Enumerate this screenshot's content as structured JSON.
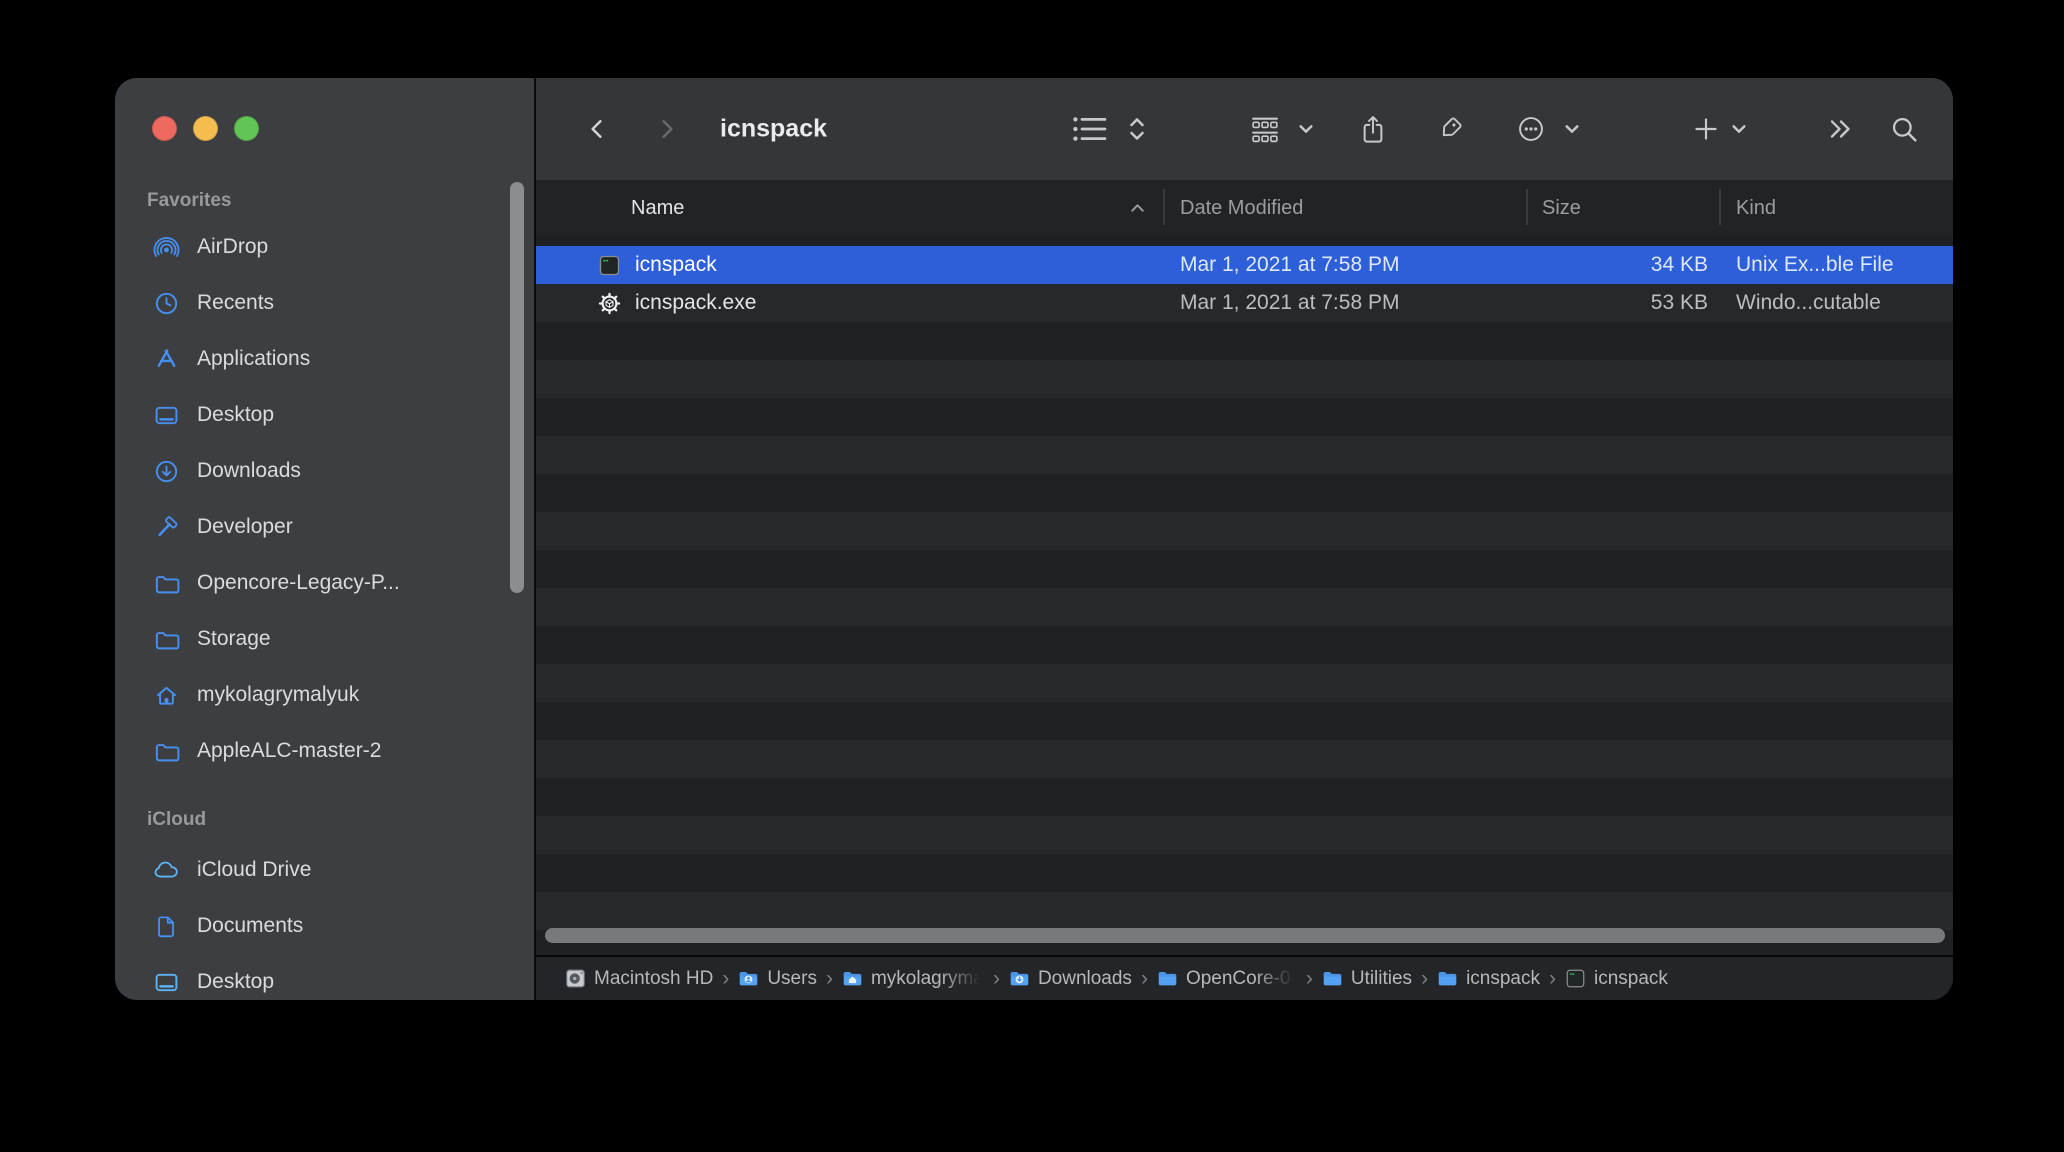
{
  "window": {
    "title": "icnspack"
  },
  "colors": {
    "accent_blue": "#2d5fd9",
    "sidebar_icon_blue": "#4690f3",
    "sidebar_icon_light_blue": "#5cb3f6",
    "folder_blue": "#55a1f2",
    "traffic_red": "#ee6a5f",
    "traffic_yellow": "#f5bd4f",
    "traffic_green": "#62c454"
  },
  "toolbar": {
    "icons": [
      "chevron-left-icon",
      "chevron-right-icon",
      "list-view-icon",
      "chevrons-up-down-icon",
      "group-view-icon",
      "share-icon",
      "tag-icon",
      "ellipsis-circle-icon",
      "chevron-down-icon",
      "plus-icon",
      "double-chevron-icon",
      "search-icon"
    ]
  },
  "sidebar": {
    "sections": [
      {
        "title": "Favorites",
        "items": [
          {
            "label": "AirDrop",
            "icon": "airdrop-icon"
          },
          {
            "label": "Recents",
            "icon": "clock-icon"
          },
          {
            "label": "Applications",
            "icon": "appstore-icon"
          },
          {
            "label": "Desktop",
            "icon": "desktop-icon"
          },
          {
            "label": "Downloads",
            "icon": "download-circle-icon"
          },
          {
            "label": "Developer",
            "icon": "hammer-icon"
          },
          {
            "label": "Opencore-Legacy-P...",
            "icon": "folder-icon"
          },
          {
            "label": "Storage",
            "icon": "folder-icon"
          },
          {
            "label": "mykolagrymalyuk",
            "icon": "home-icon"
          },
          {
            "label": "AppleALC-master-2",
            "icon": "folder-icon"
          }
        ]
      },
      {
        "title": "iCloud",
        "items": [
          {
            "label": "iCloud Drive",
            "icon": "icloud-icon",
            "tint": "light"
          },
          {
            "label": "Documents",
            "icon": "document-icon"
          },
          {
            "label": "Desktop",
            "icon": "desktop-icon",
            "tint": "light"
          }
        ]
      }
    ]
  },
  "list": {
    "columns": [
      {
        "label": "Name",
        "sorted": true
      },
      {
        "label": "Date Modified"
      },
      {
        "label": "Size"
      },
      {
        "label": "Kind"
      }
    ],
    "rows": [
      {
        "name": "icnspack",
        "icon": "terminal-file-icon",
        "date": "Mar 1, 2021 at 7:58 PM",
        "size": "34 KB",
        "kind": "Unix Ex...ble File",
        "selected": true
      },
      {
        "name": "icnspack.exe",
        "icon": "exe-file-icon",
        "date": "Mar 1, 2021 at 7:58 PM",
        "size": "53 KB",
        "kind": "Windo...cutable",
        "selected": false
      }
    ]
  },
  "pathbar": {
    "items": [
      {
        "label": "Macintosh HD",
        "icon": "hard-drive-icon"
      },
      {
        "label": "Users",
        "icon": "folder-users-icon"
      },
      {
        "label": "mykolagryma",
        "icon": "folder-home-icon",
        "faded": true
      },
      {
        "label": "Downloads",
        "icon": "folder-downloads-icon"
      },
      {
        "label": "OpenCore-0-",
        "icon": "folder-icon",
        "faded": true
      },
      {
        "label": "Utilities",
        "icon": "folder-icon"
      },
      {
        "label": "icnspack",
        "icon": "folder-icon"
      },
      {
        "label": "icnspack",
        "icon": "terminal-file-icon"
      }
    ]
  }
}
